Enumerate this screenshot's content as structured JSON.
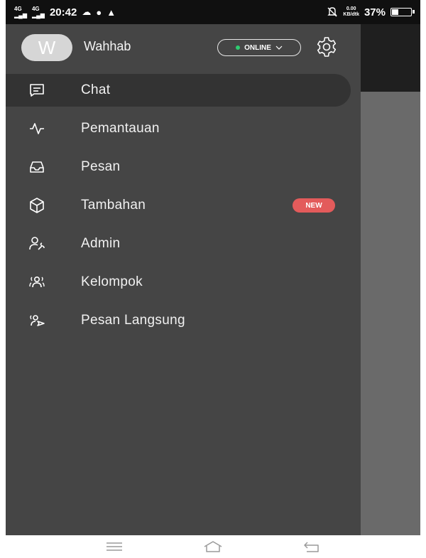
{
  "status_bar": {
    "network_1": "4G",
    "network_2": "4G",
    "time": "20:42",
    "data_speed_value": "0.00",
    "data_speed_unit": "KB/dtk",
    "battery_percent": "37%",
    "battery_level": 0.37
  },
  "drawer": {
    "avatar_initial": "W",
    "username": "Wahhab",
    "status_label": "ONLINE",
    "status_color": "#2ecc71",
    "accent_badge_color": "#e35b5b",
    "items": [
      {
        "label": "Chat",
        "icon": "chat-icon",
        "active": true
      },
      {
        "label": "Pemantauan",
        "icon": "pulse-icon"
      },
      {
        "label": "Pesan",
        "icon": "inbox-icon"
      },
      {
        "label": "Tambahan",
        "icon": "cube-icon",
        "badge": "NEW"
      },
      {
        "label": "Admin",
        "icon": "admin-icon"
      },
      {
        "label": "Kelompok",
        "icon": "group-icon"
      },
      {
        "label": "Pesan Langsung",
        "icon": "direct-message-icon"
      }
    ]
  },
  "navbar": {
    "icons": [
      "menu-icon",
      "home-icon",
      "back-icon"
    ]
  }
}
